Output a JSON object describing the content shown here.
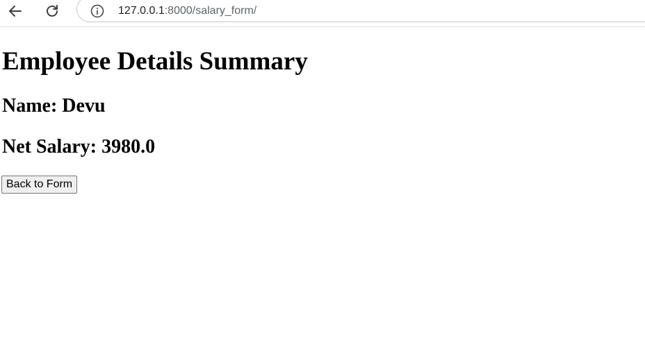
{
  "browser": {
    "url_host": "127.0.0.1",
    "url_path": ":8000/salary_form/",
    "icons": {
      "back": "arrow-left-icon",
      "reload": "reload-icon",
      "info": "info-icon"
    }
  },
  "page": {
    "title": "Employee Details Summary",
    "name_line": "Name: Devu",
    "salary_line": "Net Salary: 3980.0",
    "back_button_label": "Back to Form"
  }
}
